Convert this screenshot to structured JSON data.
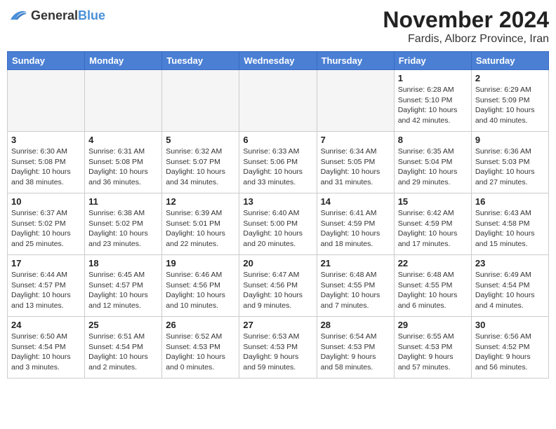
{
  "header": {
    "logo_general": "General",
    "logo_blue": "Blue",
    "month": "November 2024",
    "location": "Fardis, Alborz Province, Iran"
  },
  "weekdays": [
    "Sunday",
    "Monday",
    "Tuesday",
    "Wednesday",
    "Thursday",
    "Friday",
    "Saturday"
  ],
  "weeks": [
    [
      {
        "day": "",
        "info": ""
      },
      {
        "day": "",
        "info": ""
      },
      {
        "day": "",
        "info": ""
      },
      {
        "day": "",
        "info": ""
      },
      {
        "day": "",
        "info": ""
      },
      {
        "day": "1",
        "info": "Sunrise: 6:28 AM\nSunset: 5:10 PM\nDaylight: 10 hours and 42 minutes."
      },
      {
        "day": "2",
        "info": "Sunrise: 6:29 AM\nSunset: 5:09 PM\nDaylight: 10 hours and 40 minutes."
      }
    ],
    [
      {
        "day": "3",
        "info": "Sunrise: 6:30 AM\nSunset: 5:08 PM\nDaylight: 10 hours and 38 minutes."
      },
      {
        "day": "4",
        "info": "Sunrise: 6:31 AM\nSunset: 5:08 PM\nDaylight: 10 hours and 36 minutes."
      },
      {
        "day": "5",
        "info": "Sunrise: 6:32 AM\nSunset: 5:07 PM\nDaylight: 10 hours and 34 minutes."
      },
      {
        "day": "6",
        "info": "Sunrise: 6:33 AM\nSunset: 5:06 PM\nDaylight: 10 hours and 33 minutes."
      },
      {
        "day": "7",
        "info": "Sunrise: 6:34 AM\nSunset: 5:05 PM\nDaylight: 10 hours and 31 minutes."
      },
      {
        "day": "8",
        "info": "Sunrise: 6:35 AM\nSunset: 5:04 PM\nDaylight: 10 hours and 29 minutes."
      },
      {
        "day": "9",
        "info": "Sunrise: 6:36 AM\nSunset: 5:03 PM\nDaylight: 10 hours and 27 minutes."
      }
    ],
    [
      {
        "day": "10",
        "info": "Sunrise: 6:37 AM\nSunset: 5:02 PM\nDaylight: 10 hours and 25 minutes."
      },
      {
        "day": "11",
        "info": "Sunrise: 6:38 AM\nSunset: 5:02 PM\nDaylight: 10 hours and 23 minutes."
      },
      {
        "day": "12",
        "info": "Sunrise: 6:39 AM\nSunset: 5:01 PM\nDaylight: 10 hours and 22 minutes."
      },
      {
        "day": "13",
        "info": "Sunrise: 6:40 AM\nSunset: 5:00 PM\nDaylight: 10 hours and 20 minutes."
      },
      {
        "day": "14",
        "info": "Sunrise: 6:41 AM\nSunset: 4:59 PM\nDaylight: 10 hours and 18 minutes."
      },
      {
        "day": "15",
        "info": "Sunrise: 6:42 AM\nSunset: 4:59 PM\nDaylight: 10 hours and 17 minutes."
      },
      {
        "day": "16",
        "info": "Sunrise: 6:43 AM\nSunset: 4:58 PM\nDaylight: 10 hours and 15 minutes."
      }
    ],
    [
      {
        "day": "17",
        "info": "Sunrise: 6:44 AM\nSunset: 4:57 PM\nDaylight: 10 hours and 13 minutes."
      },
      {
        "day": "18",
        "info": "Sunrise: 6:45 AM\nSunset: 4:57 PM\nDaylight: 10 hours and 12 minutes."
      },
      {
        "day": "19",
        "info": "Sunrise: 6:46 AM\nSunset: 4:56 PM\nDaylight: 10 hours and 10 minutes."
      },
      {
        "day": "20",
        "info": "Sunrise: 6:47 AM\nSunset: 4:56 PM\nDaylight: 10 hours and 9 minutes."
      },
      {
        "day": "21",
        "info": "Sunrise: 6:48 AM\nSunset: 4:55 PM\nDaylight: 10 hours and 7 minutes."
      },
      {
        "day": "22",
        "info": "Sunrise: 6:48 AM\nSunset: 4:55 PM\nDaylight: 10 hours and 6 minutes."
      },
      {
        "day": "23",
        "info": "Sunrise: 6:49 AM\nSunset: 4:54 PM\nDaylight: 10 hours and 4 minutes."
      }
    ],
    [
      {
        "day": "24",
        "info": "Sunrise: 6:50 AM\nSunset: 4:54 PM\nDaylight: 10 hours and 3 minutes."
      },
      {
        "day": "25",
        "info": "Sunrise: 6:51 AM\nSunset: 4:54 PM\nDaylight: 10 hours and 2 minutes."
      },
      {
        "day": "26",
        "info": "Sunrise: 6:52 AM\nSunset: 4:53 PM\nDaylight: 10 hours and 0 minutes."
      },
      {
        "day": "27",
        "info": "Sunrise: 6:53 AM\nSunset: 4:53 PM\nDaylight: 9 hours and 59 minutes."
      },
      {
        "day": "28",
        "info": "Sunrise: 6:54 AM\nSunset: 4:53 PM\nDaylight: 9 hours and 58 minutes."
      },
      {
        "day": "29",
        "info": "Sunrise: 6:55 AM\nSunset: 4:53 PM\nDaylight: 9 hours and 57 minutes."
      },
      {
        "day": "30",
        "info": "Sunrise: 6:56 AM\nSunset: 4:52 PM\nDaylight: 9 hours and 56 minutes."
      }
    ]
  ]
}
